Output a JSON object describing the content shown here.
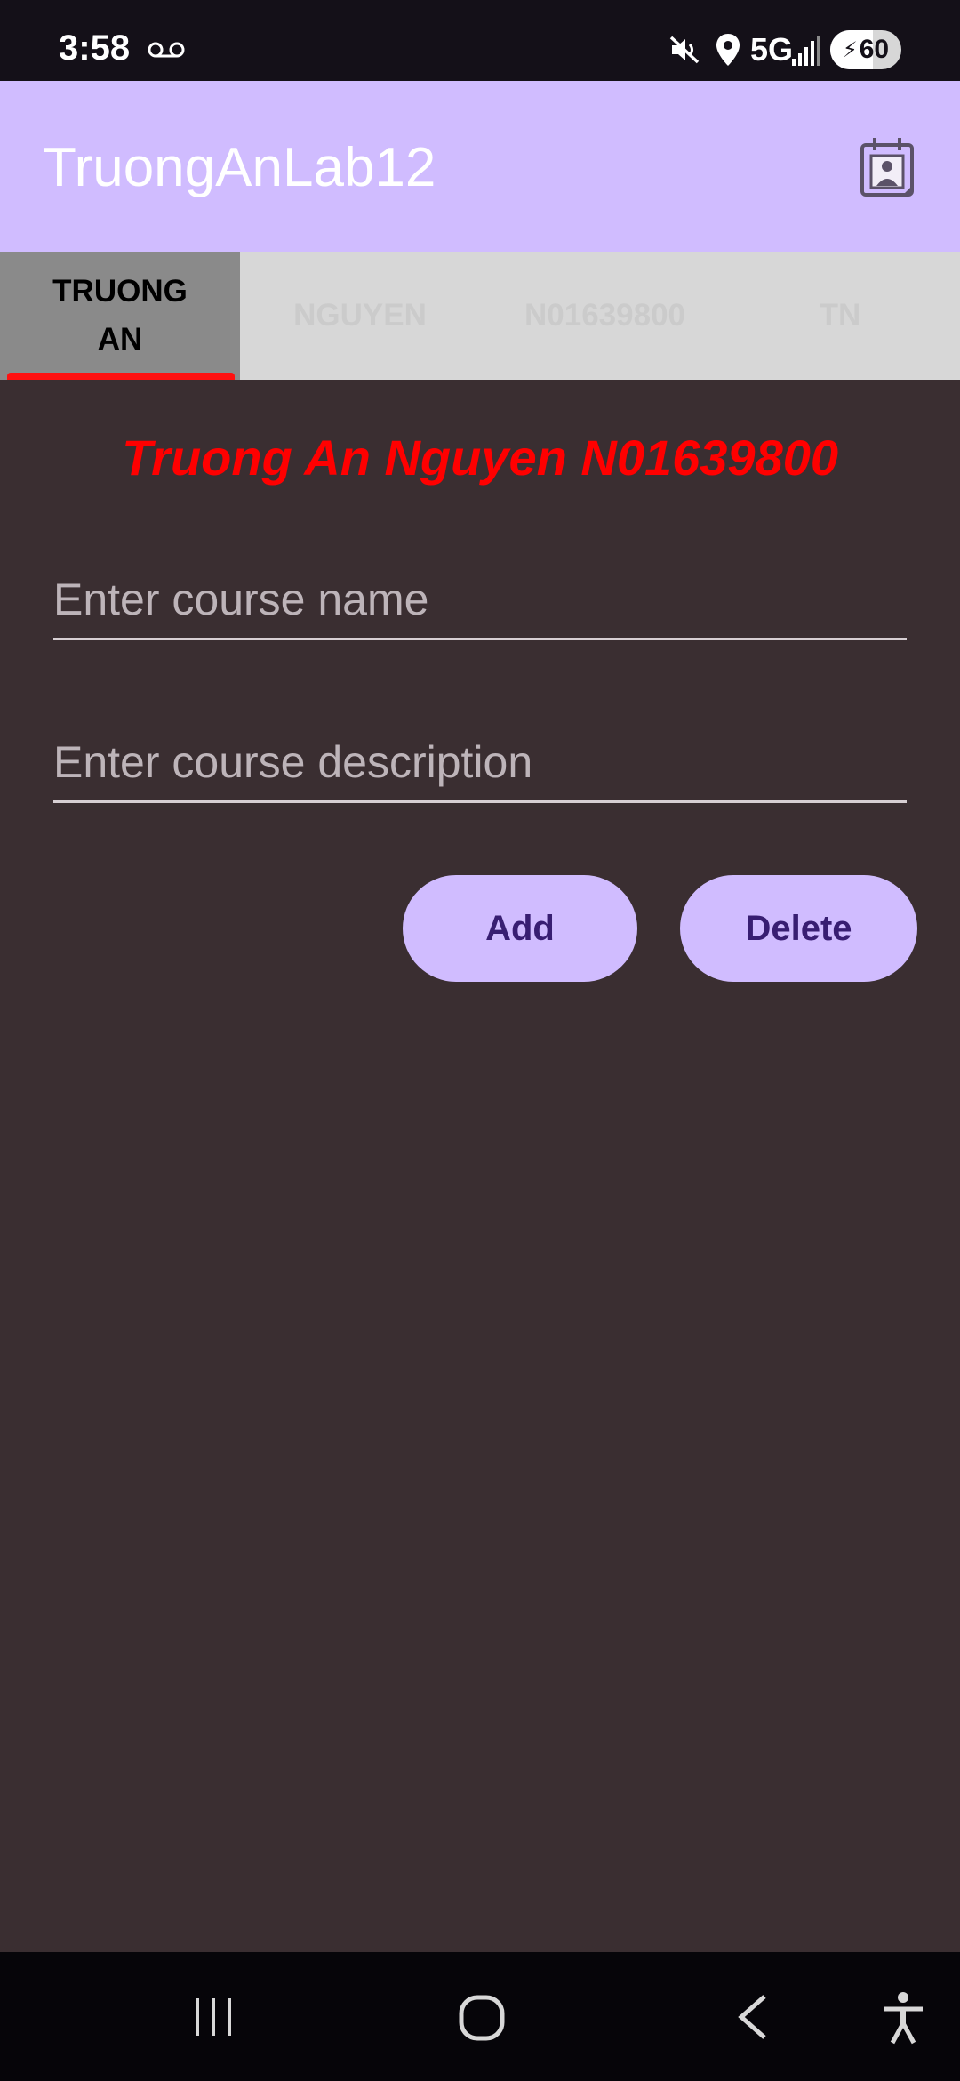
{
  "status_bar": {
    "time": "3:58",
    "network": "5G",
    "battery_level": 60,
    "battery_label": "60",
    "icons": [
      "voicemail-icon",
      "mute-icon",
      "location-icon",
      "signal-icon",
      "battery-charging-icon"
    ]
  },
  "app_bar": {
    "title": "TruongAnLab12",
    "action_icon": "contact-calendar-icon"
  },
  "tabs": [
    {
      "label": "TRUONG AN",
      "active": true
    },
    {
      "label": "NGUYEN",
      "active": false
    },
    {
      "label": "N01639800",
      "active": false
    },
    {
      "label": "TN",
      "active": false
    }
  ],
  "main": {
    "headline": "Truong An Nguyen N01639800",
    "course_name": {
      "value": "",
      "placeholder": "Enter course name"
    },
    "course_description": {
      "value": "",
      "placeholder": "Enter course description"
    },
    "add_label": "Add",
    "delete_label": "Delete"
  },
  "nav_bar": {
    "buttons": [
      "recent-apps-icon",
      "home-icon",
      "back-icon",
      "accessibility-icon"
    ]
  },
  "colors": {
    "app_bar": "#d0bcff",
    "background": "#3a2e31",
    "headline": "#ff0000",
    "tab_indicator": "#ff1010",
    "button_text": "#381e72"
  }
}
